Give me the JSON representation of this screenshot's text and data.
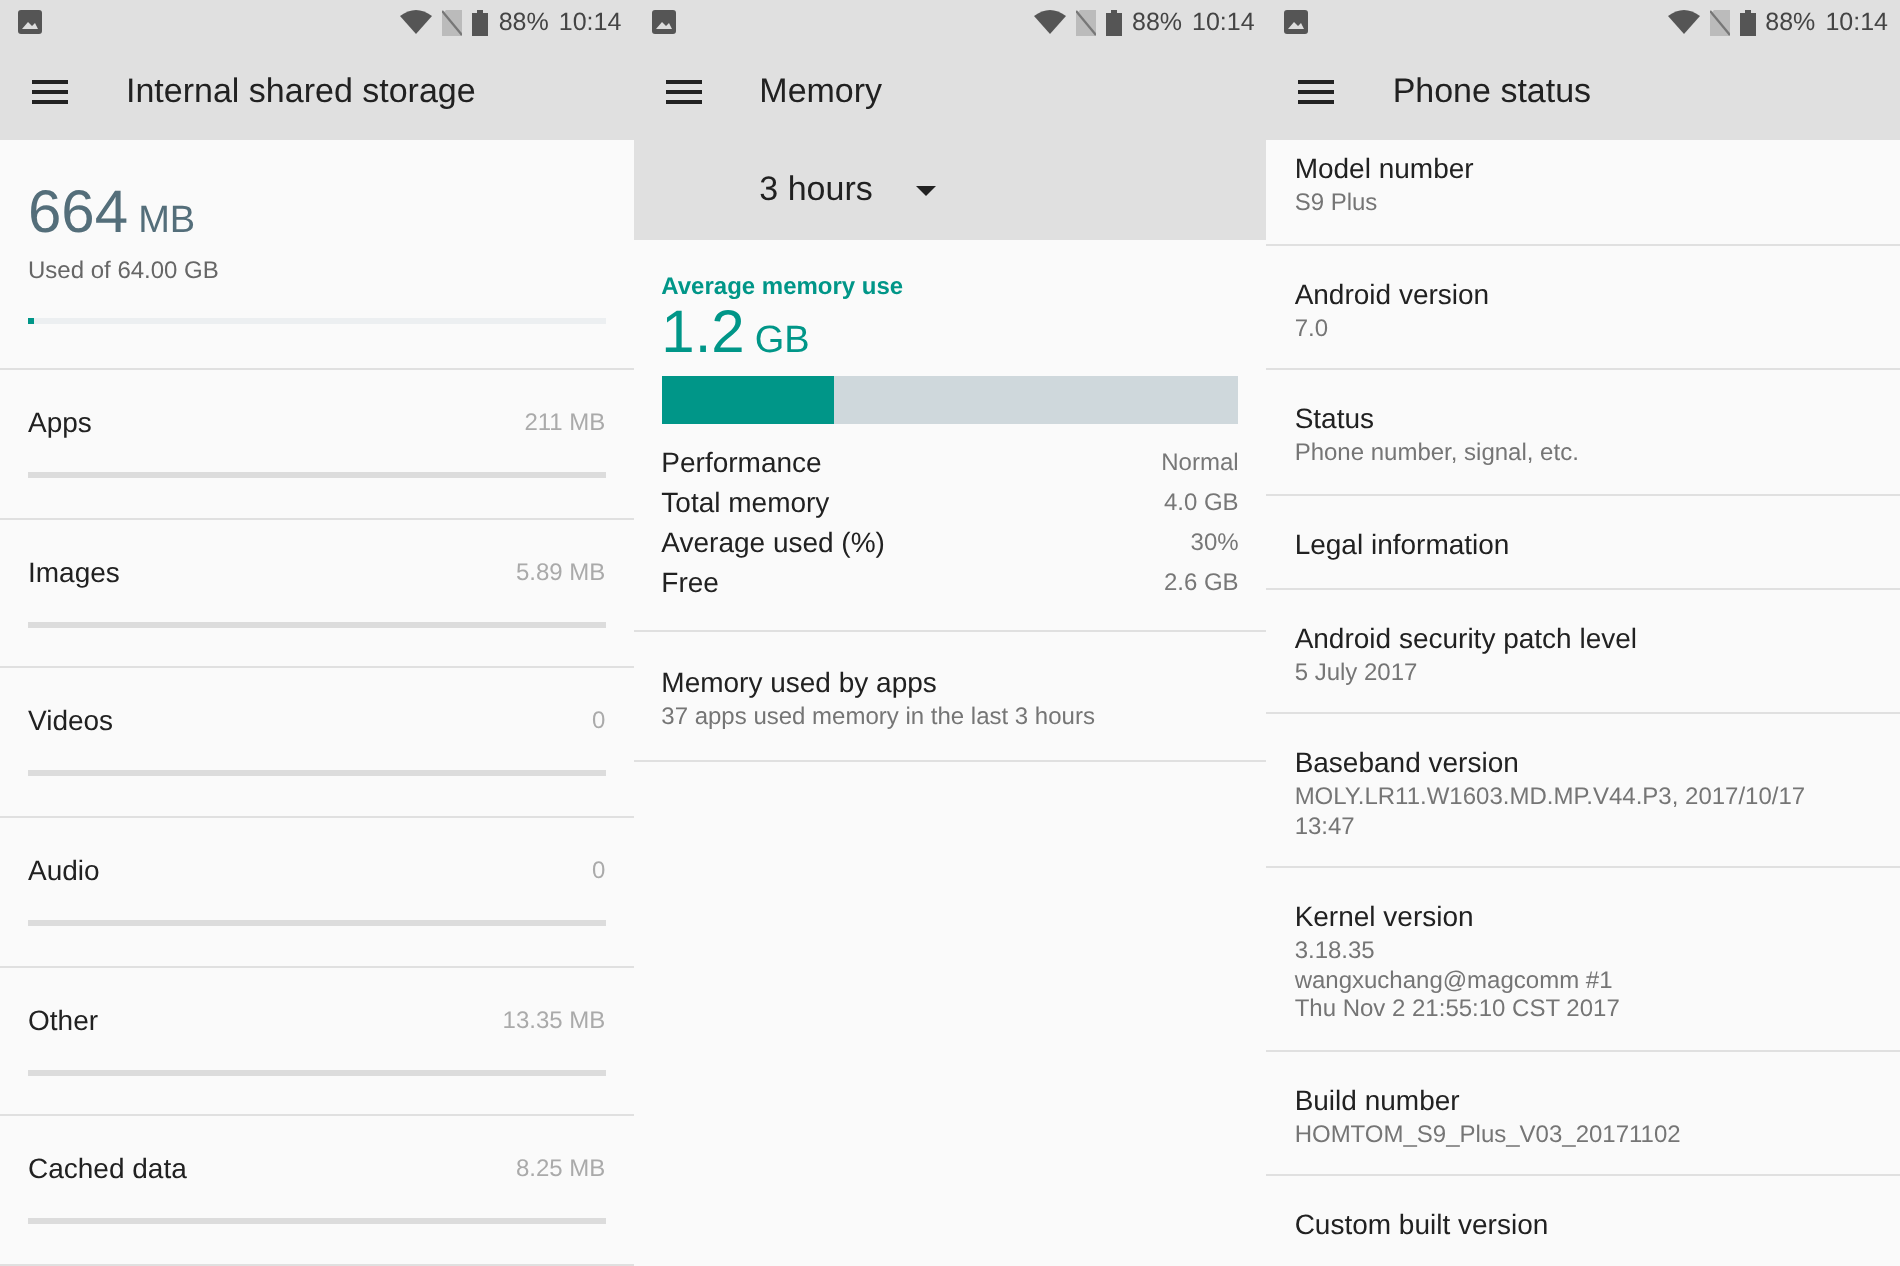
{
  "screens": [
    {
      "kind": "storage",
      "status_bar": {
        "battery": "88%",
        "time": "10:14"
      },
      "title": "Internal shared storage",
      "summary": {
        "amount": "664",
        "unit": "MB",
        "caption": "Used of 64.00 GB",
        "level": 0.01
      },
      "categories": [
        {
          "label": "Apps",
          "size": "211 MB"
        },
        {
          "label": "Images",
          "size": "5.89 MB"
        },
        {
          "label": "Videos",
          "size": "0"
        },
        {
          "label": "Audio",
          "size": "0"
        },
        {
          "label": "Other",
          "size": "13.35 MB"
        },
        {
          "label": "Cached data",
          "size": "8.25 MB"
        }
      ]
    },
    {
      "kind": "memory",
      "status_bar": {
        "battery": "88%",
        "time": "10:14"
      },
      "title": "Memory",
      "period": "3 hours",
      "average": {
        "label": "Average memory use",
        "amount": "1.2",
        "unit": "GB",
        "level": 0.3
      },
      "stats": [
        {
          "label": "Performance",
          "value": "Normal"
        },
        {
          "label": "Total memory",
          "value": "4.0 GB"
        },
        {
          "label": "Average used (%)",
          "value": "30%"
        },
        {
          "label": "Free",
          "value": "2.6 GB"
        }
      ],
      "apps_item": {
        "title": "Memory used by apps",
        "subtitle": "37 apps used memory in the last 3 hours"
      }
    },
    {
      "kind": "status",
      "status_bar": {
        "battery": "88%",
        "time": "10:14"
      },
      "title": "Phone status",
      "items": [
        {
          "title": "Model number",
          "lines": [
            "S9 Plus"
          ]
        },
        {
          "title": "Android version",
          "lines": [
            "7.0"
          ]
        },
        {
          "title": "Status",
          "lines": [
            "Phone number, signal, etc."
          ]
        },
        {
          "title": "Legal information"
        },
        {
          "title": "Android security patch level",
          "lines": [
            "5 July 2017"
          ]
        },
        {
          "title": "Baseband version",
          "lines": [
            "MOLY.LR11.W1603.MD.MP.V44.P3, 2017/10/17",
            "13:47"
          ]
        },
        {
          "title": "Kernel version",
          "lines": [
            "3.18.35",
            "wangxuchang@magcomm #1",
            "Thu Nov 2 21:55:10 CST 2017"
          ]
        },
        {
          "title": "Build number",
          "lines": [
            "HOMTOM_S9_Plus_V03_20171102"
          ]
        },
        {
          "title": "Custom built version"
        }
      ]
    }
  ]
}
